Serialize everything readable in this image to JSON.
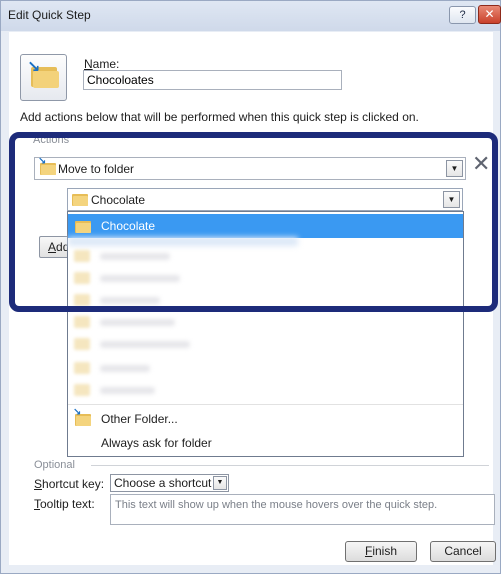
{
  "window": {
    "title": "Edit Quick Step",
    "help_label": "?",
    "close_label": "✕"
  },
  "header": {
    "name_label": "Name:",
    "name_value": "Chocoloates"
  },
  "instructions": "Add actions below that will be performed when this quick step is clicked on.",
  "actions": {
    "section_label": "Actions",
    "action_value": "Move to folder",
    "remove_label": "✕",
    "folder_value": "Chocolate",
    "add_button_label": "Add"
  },
  "dropdown": {
    "selected_item": "Chocolate",
    "other_folder": "Other Folder...",
    "always_ask": "Always ask for folder"
  },
  "optional": {
    "section_label": "Optional",
    "shortcut_label": "Shortcut key:",
    "shortcut_value": "Choose a shortcut",
    "tooltip_label": "Tooltip text:",
    "tooltip_placeholder": "This text will show up when the mouse hovers over the quick step."
  },
  "buttons": {
    "finish": "Finish",
    "cancel": "Cancel"
  },
  "colors": {
    "selection": "#3a99f2",
    "highlight_border": "#1d2b7a",
    "folder": "#f4d47e"
  }
}
